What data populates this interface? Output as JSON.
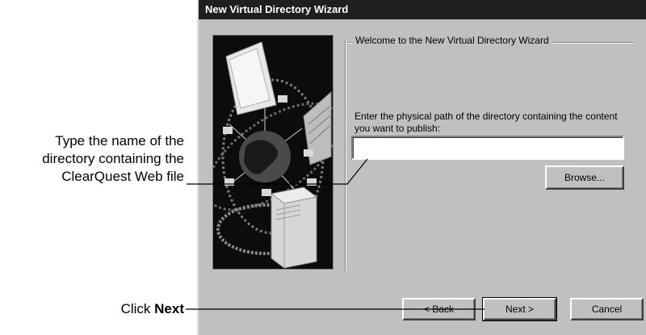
{
  "callouts": {
    "type_name_lines": [
      "Type the name of the",
      "directory containing the",
      "ClearQuest Web file"
    ],
    "click_prefix": "Click ",
    "click_bold": "Next"
  },
  "window": {
    "title": "New Virtual Directory Wizard"
  },
  "wizard": {
    "group_title": "Welcome to the New Virtual Directory Wizard",
    "prompt": "Enter the physical path of the directory containing the content you want to publish:",
    "path_value": "",
    "browse_label": "Browse..."
  },
  "buttons": {
    "back": "< Back",
    "next": "Next >",
    "cancel": "Cancel"
  },
  "icons": {
    "side_image": "globe-network-icon"
  }
}
